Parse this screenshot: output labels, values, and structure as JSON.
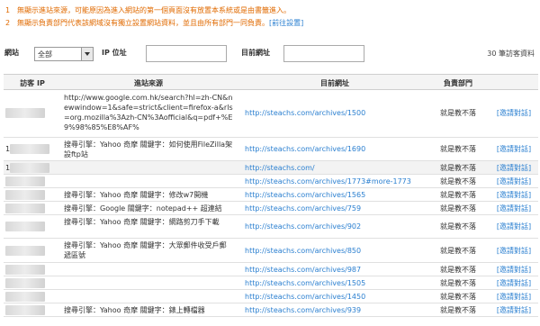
{
  "notes": [
    {
      "num": "1",
      "text": "無顯示進站來源，可能原因為進入網站的第一個頁面沒有放置本系統或是由書籤進入。"
    },
    {
      "num": "2",
      "text": "無顯示負責部門代表該網域沒有獨立設置網站資料，並且由所有部門一同負責。",
      "link": "[前往設置]"
    }
  ],
  "filter": {
    "site_label": "網站",
    "site_value": "全部",
    "ip_label": "IP 位址",
    "url_label": "目前網址",
    "visitor_count": "30 筆訪客資料"
  },
  "table": {
    "headers": [
      "訪客 IP",
      "進站來源",
      "目前網址",
      "負責部門",
      ""
    ],
    "rows": [
      {
        "ip": "",
        "source": "http://www.google.com.hk/search?hl=zh-CN&newwindow=1&safe=strict&client=firefox-a&rls=org.mozilla%3Azh-CN%3Aofficial&q=pdf+%E9%98%85%E8%AF%",
        "url": "http://steachs.com/archives/1500",
        "dept": "就是教不落",
        "action": "[邀請對話]"
      },
      {
        "ip": "1",
        "source": "搜尋引擎：Yahoo 奇摩  關鍵字：如何使用FileZilla架設ftp站",
        "url": "http://steachs.com/archives/1690",
        "dept": "就是教不落",
        "action": "[邀請對話]"
      },
      {
        "ip": "1",
        "source": "",
        "url": "http://steachs.com/",
        "dept": "就是教不落",
        "action": "[邀請對話]"
      },
      {
        "ip": "",
        "source": "",
        "url": "http://steachs.com/archives/1773#more-1773",
        "dept": "就是教不落",
        "action": "[邀請對話]"
      },
      {
        "ip": "",
        "source": "搜尋引擎：Yahoo 奇摩  關鍵字：修改w7開機",
        "url": "http://steachs.com/archives/1565",
        "dept": "就是教不落",
        "action": "[邀請對話]"
      },
      {
        "ip": "",
        "source": "搜尋引擎：Google  關鍵字：notepad++ 超連結",
        "url": "http://steachs.com/archives/759",
        "dept": "就是教不落",
        "action": "[邀請對話]"
      },
      {
        "ip": "",
        "source": "搜尋引擎：Yahoo 奇摩  關鍵字：網路剪刀手下載",
        "url": "http://steachs.com/archives/902",
        "dept": "就是教不落",
        "action": "[邀請對話]"
      },
      {
        "ip": "",
        "source": "搜尋引擎：Yahoo 奇摩  關鍵字：大眾郵件收受戶郵遞區號",
        "url": "http://steachs.com/archives/850",
        "dept": "就是教不落",
        "action": "[邀請對話]"
      },
      {
        "ip": "",
        "source": "",
        "url": "http://steachs.com/archives/987",
        "dept": "就是教不落",
        "action": "[邀請對話]"
      },
      {
        "ip": "",
        "source": "",
        "url": "http://steachs.com/archives/1505",
        "dept": "就是教不落",
        "action": "[邀請對話]"
      },
      {
        "ip": "",
        "source": "",
        "url": "http://steachs.com/archives/1450",
        "dept": "就是教不落",
        "action": "[邀請對話]"
      },
      {
        "ip": "",
        "source": "搜尋引擎：Yahoo 奇摩  關鍵字：錶上轉檔器",
        "url": "http://steachs.com/archives/939",
        "dept": "就是教不落",
        "action": "[邀請對話]"
      }
    ]
  }
}
